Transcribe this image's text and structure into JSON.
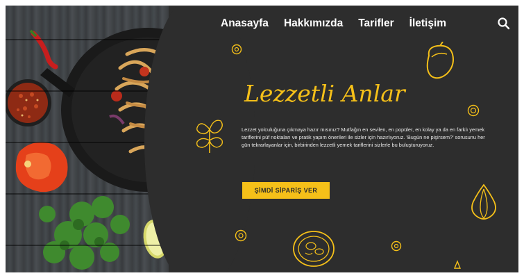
{
  "nav": {
    "items": [
      {
        "label": "Anasayfa"
      },
      {
        "label": "Hakkımızda"
      },
      {
        "label": "Tarifler"
      },
      {
        "label": "İletişim"
      }
    ],
    "search_icon": "search-icon"
  },
  "hero": {
    "title": "Lezzetli Anlar",
    "description": "Lezzet yolculuğuna çıkmaya hazır mısınız? Mutfağın en sevilen, en popüler, en kolay ya da en farklı yemek tariflerini püf noktaları ve pratik yapım önerileri ile sizler için hazırlıyoruz. 'Bugün ne pişirsem?' sorusunu her gün tekrarlayanlar için, birbirinden lezzetli yemek tariflerini sizlerle bu buluşturuyoruz.",
    "cta_label": "ŞİMDİ SİPARİŞ VER"
  },
  "colors": {
    "panel": "#2d2d2d",
    "accent": "#f5c019",
    "text": "#ffffff"
  }
}
